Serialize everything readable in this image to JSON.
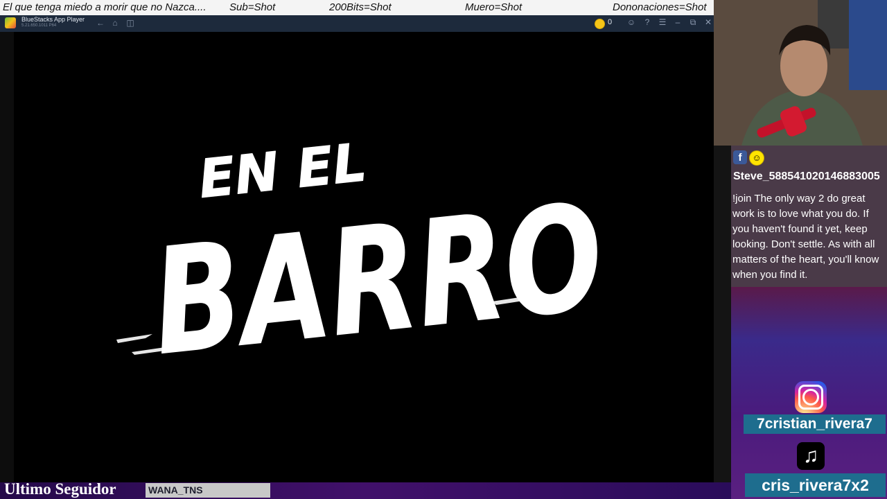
{
  "ticker": {
    "items": [
      "El que tenga miedo a morir que no Nazca....",
      "Sub=Shot",
      "200Bits=Shot",
      "Muero=Shot",
      "Dononaciones=Shot"
    ]
  },
  "titlebar": {
    "app_name": "BlueStacks App Player",
    "version": "5.21.650.1011 P64",
    "coins": "0"
  },
  "game": {
    "logo_line1": "EN EL",
    "logo_line2": "BARRO"
  },
  "chat": {
    "username": "Steve_588541020146883005",
    "message": "!join The only way 2 do great work is to love what you do. If you haven't found it yet, keep looking. Don't settle. As with all matters of the heart, you'll know when you find it."
  },
  "social": {
    "instagram": "7cristian_rivera7",
    "tiktok": "cris_rivera7x2"
  },
  "bottom": {
    "follower_label": "Ultimo Seguidor",
    "follower_name": "WANA_TNS"
  },
  "colors": {
    "ticker_bg": "#f4f4f4",
    "titlebar_bg": "#1d2a3c",
    "handle_bg": "#1e6d8e",
    "bottombar_bg": "#41106a"
  }
}
